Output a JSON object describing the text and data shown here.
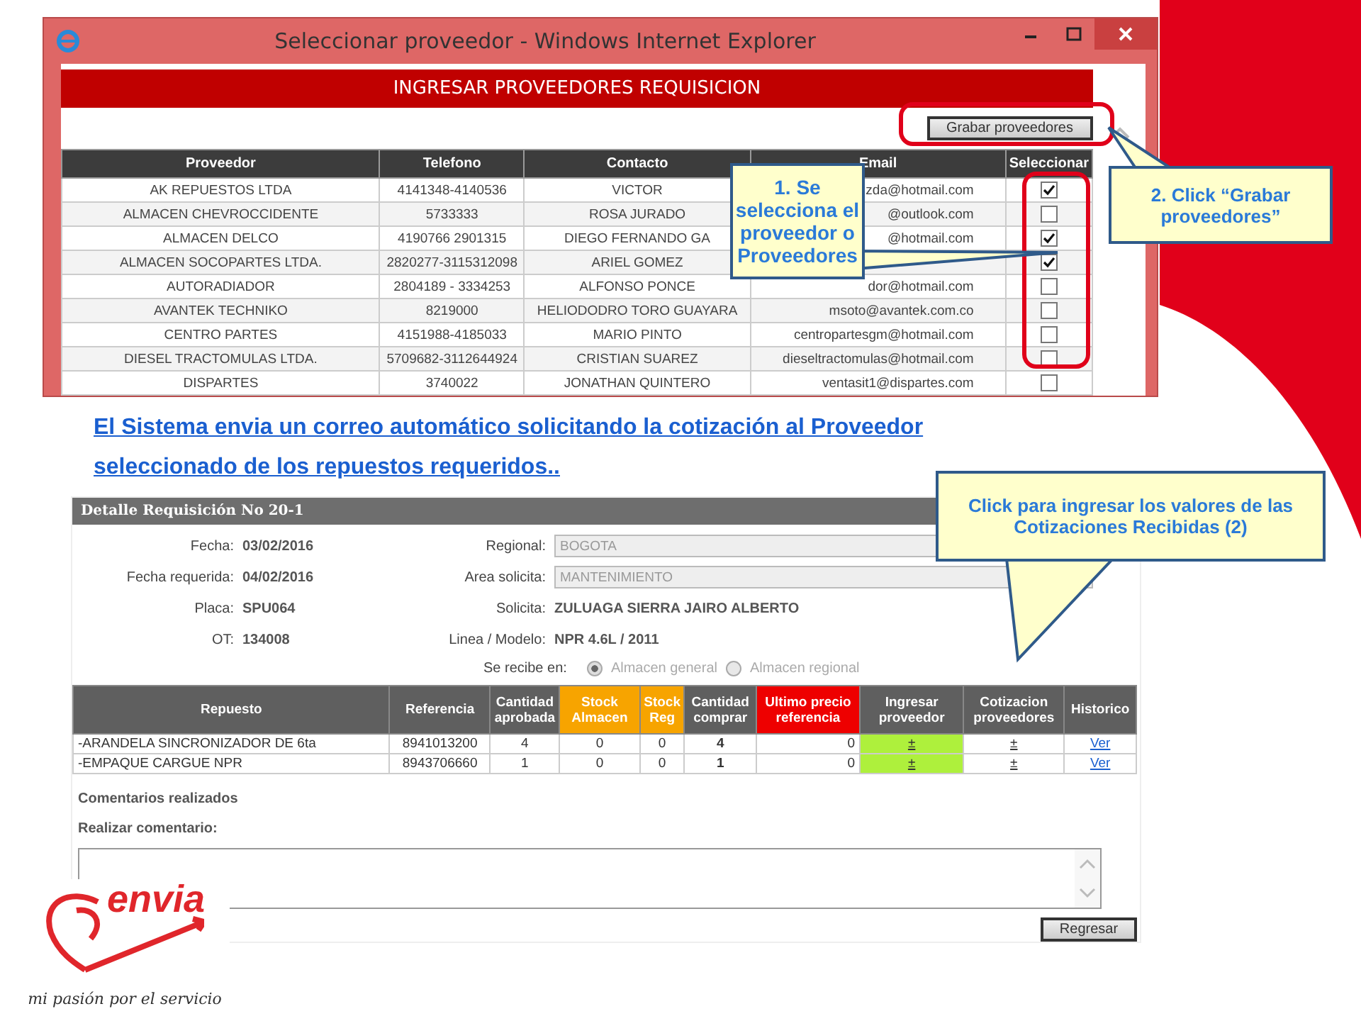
{
  "browser_window": {
    "title": "Seleccionar proveedor - Windows Internet Explorer",
    "banner": "INGRESAR PROVEEDORES REQUISICION",
    "save_button": "Grabar proveedores",
    "columns": [
      "Proveedor",
      "Telefono",
      "Contacto",
      "Email",
      "Seleccionar"
    ],
    "rows": [
      {
        "proveedor": "AK REPUESTOS LTDA",
        "telefono": "4141348-4140536",
        "contacto": "VICTOR",
        "email": "zda@hotmail.com",
        "checked": true
      },
      {
        "proveedor": "ALMACEN CHEVROCCIDENTE",
        "telefono": "5733333",
        "contacto": "ROSA JURADO",
        "email": "@outlook.com",
        "checked": false
      },
      {
        "proveedor": "ALMACEN DELCO",
        "telefono": "4190766 2901315",
        "contacto": "DIEGO FERNANDO GA",
        "email": "@hotmail.com",
        "checked": true
      },
      {
        "proveedor": "ALMACEN SOCOPARTES LTDA.",
        "telefono": "2820277-3115312098",
        "contacto": "ARIEL GOMEZ",
        "checked": true
      },
      {
        "proveedor": "AUTORADIADOR",
        "telefono": "2804189 - 3334253",
        "contacto": "ALFONSO PONCE",
        "email": "dor@hotmail.com",
        "checked": false
      },
      {
        "proveedor": "AVANTEK TECHNIKO",
        "telefono": "8219000",
        "contacto": "HELIODODRO TORO GUAYARA",
        "email": "msoto@avantek.com.co",
        "checked": false
      },
      {
        "proveedor": "CENTRO PARTES",
        "telefono": "4151988-4185033",
        "contacto": "MARIO PINTO",
        "email": "centropartesgm@hotmail.com",
        "checked": false
      },
      {
        "proveedor": "DIESEL TRACTOMULAS LTDA.",
        "telefono": "5709682-3112644924",
        "contacto": "CRISTIAN SUAREZ",
        "email": "dieseltractomulas@hotmail.com",
        "checked": false
      },
      {
        "proveedor": "DISPARTES",
        "telefono": "3740022",
        "contacto": "JONATHAN QUINTERO",
        "email": "ventasit1@dispartes.com",
        "checked": false
      }
    ]
  },
  "link_text": "El Sistema envia un correo automático solicitando la cotización al Proveedor seleccionado de los repuestos requeridos..",
  "detail": {
    "title": "Detalle Requisición No 20-1",
    "left_fields": [
      {
        "label": "Fecha:",
        "value": "03/02/2016"
      },
      {
        "label": "Fecha requerida:",
        "value": "04/02/2016"
      },
      {
        "label": "Placa:",
        "value": "SPU064"
      },
      {
        "label": "OT:",
        "value": "134008"
      }
    ],
    "right_fields": [
      {
        "label": "Regional:",
        "value": "BOGOTA",
        "kind": "input",
        "disabled": true
      },
      {
        "label": "Area solicita:",
        "value": "MANTENIMIENTO",
        "kind": "select",
        "disabled": true
      },
      {
        "label": "Solicita:",
        "value": "ZULUAGA SIERRA JAIRO ALBERTO",
        "kind": "text"
      },
      {
        "label": "Linea / Modelo:",
        "value": "NPR 4.6L / 2011",
        "kind": "text"
      }
    ],
    "receive_label": "Se recibe en:",
    "receive_options": [
      {
        "label": "Almacen general",
        "selected": true
      },
      {
        "label": "Almacen regional",
        "selected": false
      }
    ],
    "columns": [
      {
        "label": "Repuesto",
        "color": "#5f5f5f",
        "kind": "text"
      },
      {
        "label": "Referencia",
        "color": "#5f5f5f",
        "kind": "center"
      },
      {
        "label": "Cantidad aprobada",
        "color": "#5f5f5f",
        "kind": "center"
      },
      {
        "label": "Stock Almacen",
        "color": "#f7a400",
        "kind": "center"
      },
      {
        "label": "Stock Reg",
        "color": "#f7a400",
        "kind": "center"
      },
      {
        "label": "Cantidad comprar",
        "color": "#5f5f5f",
        "kind": "bold"
      },
      {
        "label": "Ultimo precio referencia",
        "color": "#ee0000",
        "kind": "number"
      },
      {
        "label": "Ingresar proveedor",
        "color": "#5f5f5f",
        "kind": "highlighted-action"
      },
      {
        "label": "Cotizacion proveedores",
        "color": "#5f5f5f",
        "kind": "action"
      },
      {
        "label": "Historico",
        "color": "#5f5f5f",
        "kind": "link"
      }
    ],
    "rows": [
      [
        "-ARANDELA SINCRONIZADOR DE 6ta",
        "8941013200",
        "4",
        "0",
        "0",
        "4",
        "0",
        "±",
        "±",
        "Ver"
      ],
      [
        "-EMPAQUE CARGUE NPR",
        "8943706660",
        "1",
        "0",
        "0",
        "1",
        "0",
        "±",
        "±",
        "Ver"
      ]
    ],
    "comments_heading": "Comentarios realizados",
    "comment_label": "Realizar comentario:",
    "back_button": "Regresar"
  },
  "callouts": [
    {
      "text": "1. Se selecciona el proveedor o Proveedores",
      "kind": "selection"
    },
    {
      "text": "2. Click “Grabar proveedores”",
      "kind": "save"
    },
    {
      "text": "Click para ingresar los valores de las Cotizaciones Recibidas (2)",
      "kind": "quotes"
    }
  ],
  "logo": {
    "brand": "envia",
    "tagline": "mi pasión por el servicio"
  }
}
